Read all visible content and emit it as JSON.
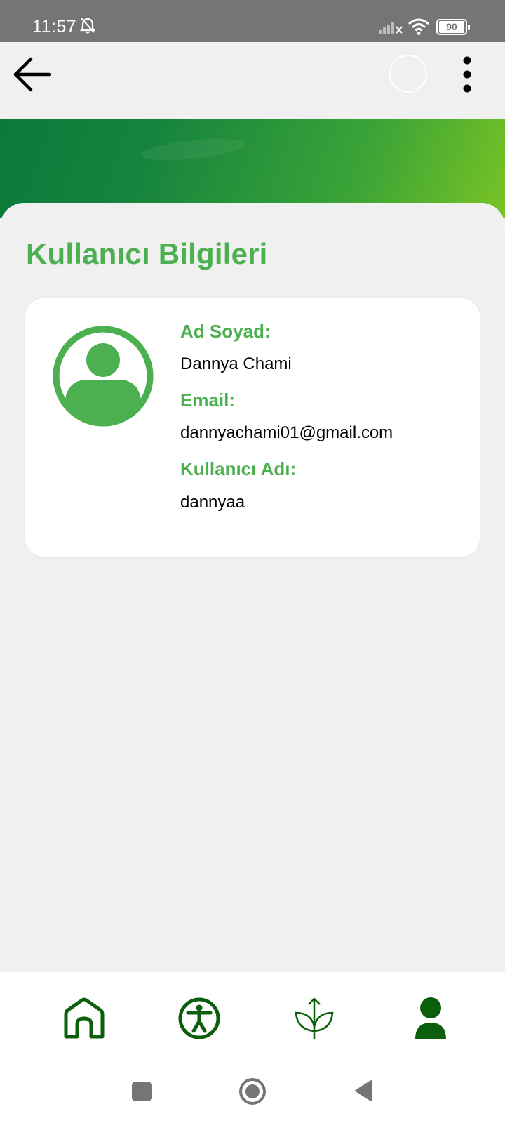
{
  "status_bar": {
    "time": "11:57",
    "battery": "90",
    "icons": [
      "bell-off-icon",
      "signal-off-icon",
      "wifi-icon",
      "battery-icon"
    ]
  },
  "app_bar": {
    "icons": [
      "back-arrow-icon",
      "profile-circle",
      "more-vertical-icon"
    ]
  },
  "page": {
    "title": "Kullanıcı Bilgileri"
  },
  "user_card": {
    "avatar_icon": "user-avatar-icon",
    "name_label": "Ad Soyad:",
    "name_value": "Dannya Chami",
    "email_label": "Email:",
    "email_value": "dannyachami01@gmail.com",
    "username_label": "Kullanıcı Adı:",
    "username_value": "dannyaa"
  },
  "bottom_nav": {
    "items": [
      {
        "icon": "home-icon"
      },
      {
        "icon": "accessibility-icon"
      },
      {
        "icon": "plant-growth-icon"
      },
      {
        "icon": "profile-icon",
        "active": true
      }
    ]
  },
  "colors": {
    "accent": "#4caf50",
    "nav_icon": "#0b5e0b",
    "header_gradient_start": "#0a7a3a",
    "header_gradient_end": "#78c324",
    "status_bar": "#757575"
  }
}
